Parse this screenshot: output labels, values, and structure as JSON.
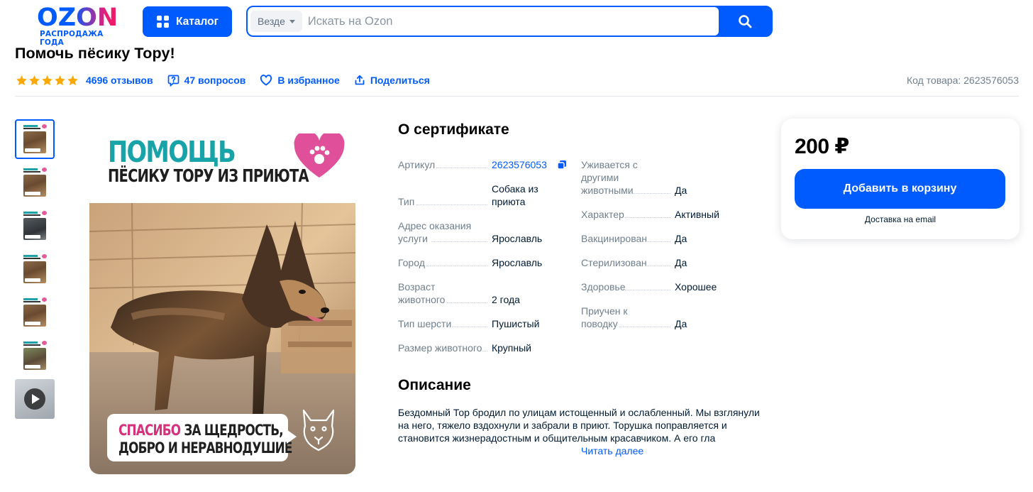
{
  "header": {
    "logo_text": "OZON",
    "logo_subtitle": "РАСПРОДАЖА ГОДА",
    "catalog_label": "Каталог",
    "search": {
      "scope": "Везде",
      "placeholder": "Искать на Ozon"
    }
  },
  "product": {
    "title": "Помочь пёсику Тору!",
    "rating_stars": 5,
    "reviews": "4696 отзывов",
    "questions": "47 вопросов",
    "favorite": "В избранное",
    "share": "Поделиться",
    "code": "Код товара: 2623576053"
  },
  "main_image": {
    "headline1": "ПОМОЩЬ",
    "headline2": "ПЁСИКУ ТОРУ ИЗ ПРИЮТА",
    "caption_pink": "СПАСИБО",
    "caption_rest": " ЗА ЩЕДРОСТЬ,",
    "caption_line2": "ДОБРО И НЕРАВНОДУШИЕ"
  },
  "certificate": {
    "heading": "О сертификате",
    "left": [
      {
        "key": "Артикул",
        "value": "2623576053",
        "is_link": true
      },
      {
        "key": "Тип",
        "value": "Собака из\nприюта"
      },
      {
        "key": "Адрес оказания\nуслуги",
        "value": "Ярославль"
      },
      {
        "key": "Город",
        "value": "Ярославль"
      },
      {
        "key": "Возраст\nживотного",
        "value": "2 года"
      },
      {
        "key": "Тип шерсти",
        "value": "Пушистый"
      },
      {
        "key": "Размер животного",
        "value": "Крупный"
      }
    ],
    "right": [
      {
        "key": "Уживается с\nдругими\nживотными",
        "value": "Да"
      },
      {
        "key": "Характер",
        "value": "Активный"
      },
      {
        "key": "Вакцинирован",
        "value": "Да"
      },
      {
        "key": "Стерилизован",
        "value": "Да"
      },
      {
        "key": "Здоровье",
        "value": "Хорошее"
      },
      {
        "key": "Приучен к\nповодку",
        "value": "Да"
      }
    ]
  },
  "description": {
    "heading": "Описание",
    "text": "Бездомный Тор бродил по улицам истощенный и ослабленный. Мы взглянули на него, тяжело вздохнули и забрали в приют. Торушка поправляется и становится жизнерадостным и общительным красавчиком. А его гла",
    "read_more": "Читать далее"
  },
  "price_card": {
    "price": "200 ₽",
    "add_to_cart": "Добавить в корзину",
    "delivery": "Доставка на email"
  },
  "colors": {
    "brand_blue": "#005bff",
    "brand_pink": "#f91155",
    "star": "#ffa800",
    "teal": "#18a3a8"
  }
}
